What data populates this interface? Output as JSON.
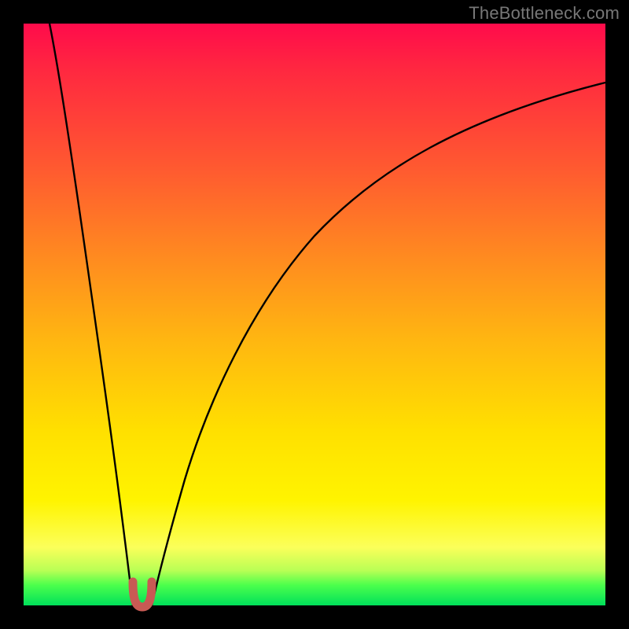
{
  "watermark": "TheBottleneck.com",
  "colors": {
    "frame": "#000000",
    "curve": "#000000",
    "marker": "#c85a54",
    "gradient_stops": [
      "#ff0b4b",
      "#ff2840",
      "#ff5a30",
      "#ff8a20",
      "#ffb810",
      "#ffe000",
      "#fff400",
      "#fbff5a",
      "#b9ff55",
      "#4cff4c",
      "#00e05a"
    ]
  },
  "chart_data": {
    "type": "line",
    "title": "",
    "xlabel": "",
    "ylabel": "",
    "xlim": [
      0,
      100
    ],
    "ylim": [
      0,
      100
    ],
    "grid": false,
    "legend": false,
    "series": [
      {
        "name": "left-branch",
        "x": [
          4.5,
          6,
          8,
          10,
          12,
          14,
          16,
          18,
          18.8
        ],
        "y": [
          100,
          92,
          78,
          63,
          48,
          33,
          18,
          4,
          0
        ]
      },
      {
        "name": "right-branch",
        "x": [
          22,
          24,
          27,
          31,
          36,
          42,
          50,
          60,
          72,
          86,
          100
        ],
        "y": [
          0,
          7,
          18,
          30,
          42,
          53,
          63,
          72,
          79,
          85,
          90
        ]
      },
      {
        "name": "bottom-marker",
        "x": [
          18.8,
          19.5,
          20.3,
          21.0,
          22.0
        ],
        "y": [
          4,
          0.5,
          0,
          0.5,
          4
        ]
      }
    ],
    "annotations": []
  }
}
